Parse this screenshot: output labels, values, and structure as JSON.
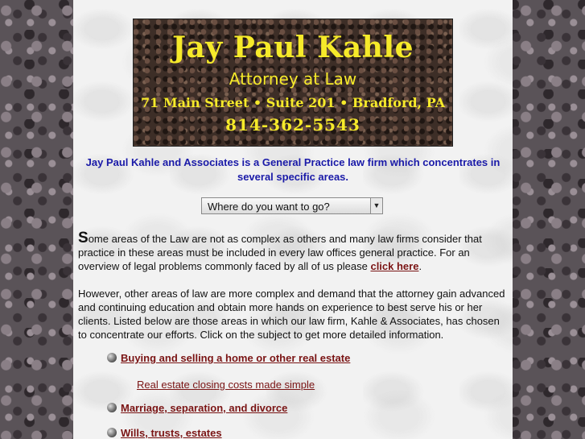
{
  "banner": {
    "name": "Jay Paul Kahle",
    "title": "Attorney at Law",
    "address": "71 Main Street • Suite 201 • Bradford, PA",
    "phone": "814-362-5543"
  },
  "intro": "Jay Paul Kahle and Associates is a General Practice law firm which concentrates in several specific areas.",
  "nav": {
    "selected": "Where do you want to go?"
  },
  "para1": {
    "drop": "S",
    "text": "ome areas of the Law are not as complex as others and many law firms consider that practice in these areas must be included in every law offices general practice. For an overview of legal problems commonly faced by all of us please ",
    "link": "click here",
    "end": "."
  },
  "para2": "However, other areas of law are more complex and demand that the attorney gain advanced and continuing education and obtain more hands on experience to best serve his or her clients. Listed below are those areas in which our law firm, Kahle & Associates, has chosen to concentrate our efforts. Click on the subject to get more detailed information.",
  "areas": [
    {
      "label": "Buying and selling a home or other real estate",
      "sub": "Real estate closing costs made simple"
    },
    {
      "label": "Marriage, separation, and divorce"
    },
    {
      "label": "Wills, trusts, estates"
    }
  ]
}
